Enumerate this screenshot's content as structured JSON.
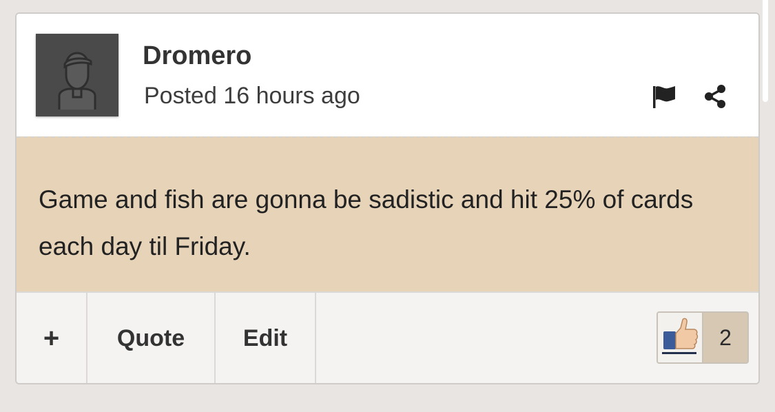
{
  "post": {
    "author": "Dromero",
    "posted": "Posted 16 hours ago",
    "message": "Game and fish are gonna be sadistic and hit 25% of cards each day til Friday."
  },
  "header_icons": [
    "flag-icon",
    "share-icon"
  ],
  "footer": {
    "plus_label": "+",
    "quote_label": "Quote",
    "edit_label": "Edit"
  },
  "reaction": {
    "icon": "thumbs-up-icon",
    "count": "2"
  },
  "colors": {
    "page_background": "#e9e5e3",
    "message_background": "#e6d3b8",
    "footer_background": "#f4f3f2",
    "avatar_background": "#4a4a4a",
    "reaction_count_background": "#d6c8b3"
  }
}
